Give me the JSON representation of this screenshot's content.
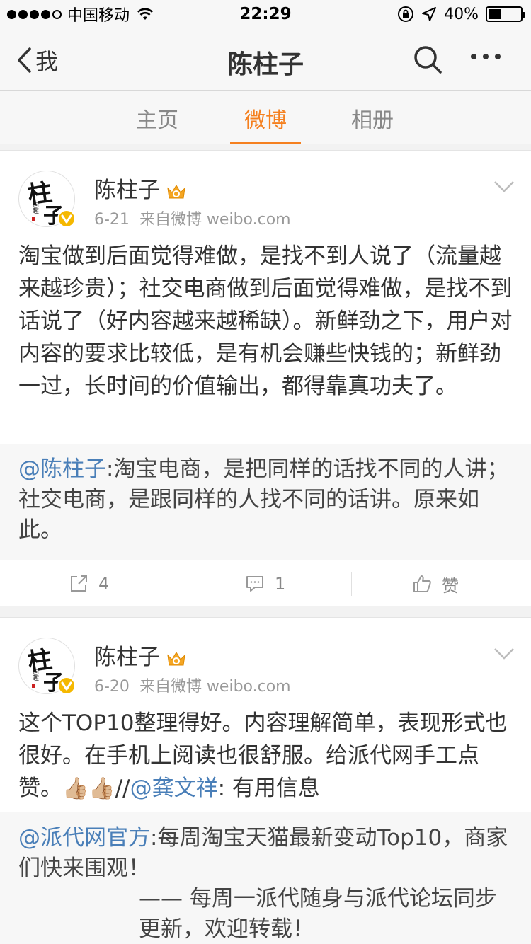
{
  "status_bar": {
    "carrier": "中国移动",
    "time": "22:29",
    "battery": "40%",
    "battery_level": 0.4
  },
  "nav": {
    "back_label": "我",
    "title": "陈柱子"
  },
  "tabs": [
    {
      "label": "主页"
    },
    {
      "label": "微博"
    },
    {
      "label": "相册"
    }
  ],
  "posts": [
    {
      "user": "陈柱子",
      "date": "6-21",
      "source": "来自微博 weibo.com",
      "text": "淘宝做到后面觉得难做，是找不到人说了（流量越来越珍贵）；社交电商做到后面觉得难做，是找不到话说了（好内容越来越稀缺）。新鲜劲之下，用户对内容的要求比较低，是有机会赚些快钱的；新鲜劲一过，长时间的价值输出，都得靠真功夫了。",
      "repost": {
        "mention": "@陈柱子",
        "text": ":淘宝电商，是把同样的话找不同的人讲；社交电商，是跟同样的人找不同的话讲。原来如此。"
      },
      "actions": {
        "repost_count": "4",
        "comment_count": "1",
        "like_label": "赞"
      }
    },
    {
      "user": "陈柱子",
      "date": "6-20",
      "source": "来自微博 weibo.com",
      "text_before": "这个TOP10整理得好。内容理解简单，表现形式也很好。在手机上阅读也很舒服。给派代网手工点赞。",
      "emoji": "👍🏼👍🏼",
      "text_slashes": "//",
      "mention": "@龚文祥",
      "text_after": ": 有用信息",
      "repost": {
        "mention": "@派代网官方",
        "text": ":每周淘宝天猫最新变动Top10，商家们快来围观！",
        "signature": "—— 每周一派代随身与派代论坛同步更新，欢迎转载！"
      }
    }
  ],
  "colors": {
    "accent": "#f5801f",
    "mention": "#4a7fb8",
    "vip": "#f5b800"
  },
  "icons": [
    "back-chevron-icon",
    "search-icon",
    "more-icon",
    "crown-icon",
    "verified-icon",
    "chevron-down-icon",
    "repost-icon",
    "comment-icon",
    "like-icon"
  ]
}
